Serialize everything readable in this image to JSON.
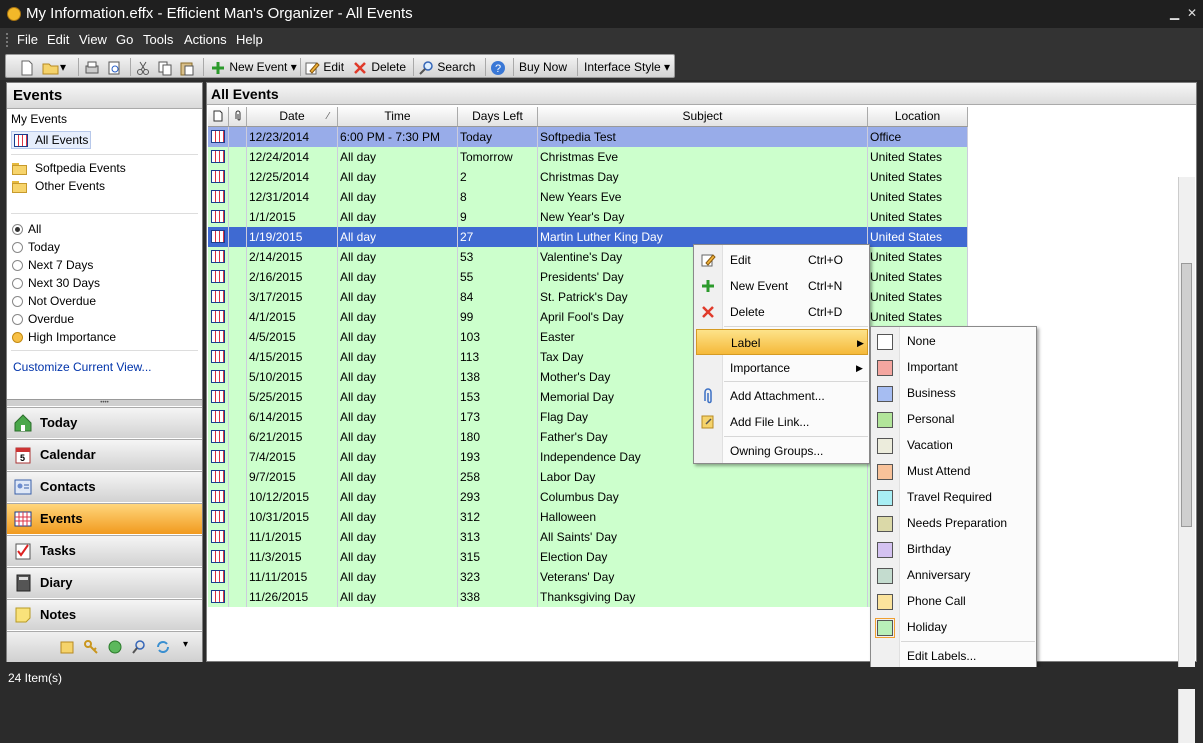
{
  "window": {
    "title": "My Information.effx - Efficient Man's Organizer - All Events"
  },
  "menu": [
    "File",
    "Edit",
    "View",
    "Go",
    "Tools",
    "Actions",
    "Help"
  ],
  "toolbar": {
    "new_event": "New Event",
    "edit": "Edit",
    "delete": "Delete",
    "search": "Search",
    "buy_now": "Buy Now",
    "interface_style": "Interface Style"
  },
  "sidebar": {
    "title": "Events",
    "my_events": "My Events",
    "all_events": "All Events",
    "groups": [
      "Softpedia Events",
      "Other Events"
    ],
    "filters": [
      "All",
      "Today",
      "Next 7 Days",
      "Next 30 Days",
      "Not Overdue",
      "Overdue",
      "High Importance"
    ],
    "customize": "Customize Current View...",
    "nav": [
      "Today",
      "Calendar",
      "Contacts",
      "Events",
      "Tasks",
      "Diary",
      "Notes"
    ]
  },
  "main": {
    "title": "All Events",
    "columns": [
      "Date",
      "Time",
      "Days Left",
      "Subject",
      "Location"
    ],
    "rows": [
      [
        "12/23/2014",
        "6:00 PM - 7:30 PM",
        "Today",
        "Softpedia Test",
        "Office"
      ],
      [
        "12/24/2014",
        "All day",
        "Tomorrow",
        "Christmas Eve",
        "United States"
      ],
      [
        "12/25/2014",
        "All day",
        "2",
        "Christmas Day",
        "United States"
      ],
      [
        "12/31/2014",
        "All day",
        "8",
        "New Years Eve",
        "United States"
      ],
      [
        "1/1/2015",
        "All day",
        "9",
        "New Year's Day",
        "United States"
      ],
      [
        "1/19/2015",
        "All day",
        "27",
        "Martin Luther King Day",
        "United States"
      ],
      [
        "2/14/2015",
        "All day",
        "53",
        "Valentine's Day",
        "United States"
      ],
      [
        "2/16/2015",
        "All day",
        "55",
        "Presidents' Day",
        "United States"
      ],
      [
        "3/17/2015",
        "All day",
        "84",
        "St. Patrick's Day",
        "United States"
      ],
      [
        "4/1/2015",
        "All day",
        "99",
        "April Fool's Day",
        "United States"
      ],
      [
        "4/5/2015",
        "All day",
        "103",
        "Easter",
        ""
      ],
      [
        "4/15/2015",
        "All day",
        "113",
        "Tax Day",
        ""
      ],
      [
        "5/10/2015",
        "All day",
        "138",
        "Mother's Day",
        ""
      ],
      [
        "5/25/2015",
        "All day",
        "153",
        "Memorial Day",
        ""
      ],
      [
        "6/14/2015",
        "All day",
        "173",
        "Flag Day",
        ""
      ],
      [
        "6/21/2015",
        "All day",
        "180",
        "Father's Day",
        ""
      ],
      [
        "7/4/2015",
        "All day",
        "193",
        "Independence Day",
        ""
      ],
      [
        "9/7/2015",
        "All day",
        "258",
        "Labor Day",
        ""
      ],
      [
        "10/12/2015",
        "All day",
        "293",
        "Columbus Day",
        ""
      ],
      [
        "10/31/2015",
        "All day",
        "312",
        "Halloween",
        ""
      ],
      [
        "11/1/2015",
        "All day",
        "313",
        "All Saints' Day",
        ""
      ],
      [
        "11/3/2015",
        "All day",
        "315",
        "Election Day",
        ""
      ],
      [
        "11/11/2015",
        "All day",
        "323",
        "Veterans' Day",
        ""
      ],
      [
        "11/26/2015",
        "All day",
        "338",
        "Thanksgiving Day",
        ""
      ]
    ]
  },
  "context_menu": {
    "edit": "Edit",
    "edit_sc": "Ctrl+O",
    "new_event": "New Event",
    "new_event_sc": "Ctrl+N",
    "delete": "Delete",
    "delete_sc": "Ctrl+D",
    "label": "Label",
    "importance": "Importance",
    "add_attachment": "Add Attachment...",
    "add_file_link": "Add File Link...",
    "owning_groups": "Owning Groups..."
  },
  "label_menu": {
    "items": [
      {
        "name": "None",
        "color": "#ffffff"
      },
      {
        "name": "Important",
        "color": "#f4a6a0"
      },
      {
        "name": "Business",
        "color": "#a6bdf2"
      },
      {
        "name": "Personal",
        "color": "#b2e59a"
      },
      {
        "name": "Vacation",
        "color": "#ececdc"
      },
      {
        "name": "Must Attend",
        "color": "#f8c29a"
      },
      {
        "name": "Travel Required",
        "color": "#a8eef4"
      },
      {
        "name": "Needs Preparation",
        "color": "#dbd9a8"
      },
      {
        "name": "Birthday",
        "color": "#d4c2f1"
      },
      {
        "name": "Anniversary",
        "color": "#c4dccf"
      },
      {
        "name": "Phone Call",
        "color": "#fbe39c"
      },
      {
        "name": "Holiday",
        "color": "#b9f0b9"
      }
    ],
    "edit_labels": "Edit Labels..."
  },
  "status": {
    "text": "24 Item(s)"
  }
}
